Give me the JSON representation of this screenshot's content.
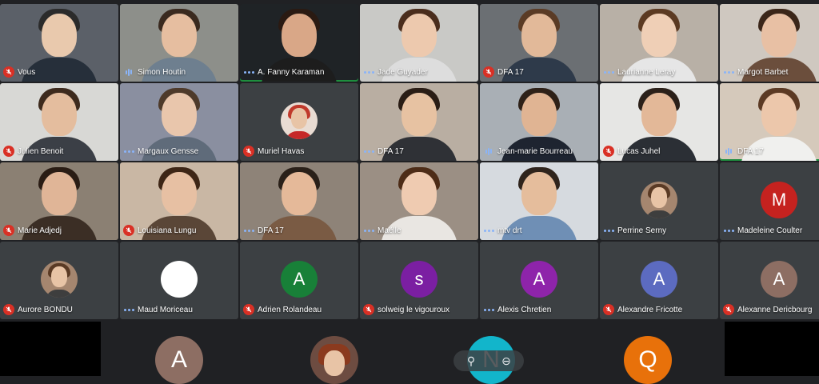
{
  "participants": [
    {
      "name": "Vous",
      "state": "muted"
    },
    {
      "name": "Simon Houtin",
      "state": "speaking"
    },
    {
      "name": "A. Fanny Karaman",
      "state": "dots"
    },
    {
      "name": "Jade Guyader",
      "state": "dots"
    },
    {
      "name": "DFA 17",
      "state": "muted"
    },
    {
      "name": "Laurianne Leray",
      "state": "dots"
    },
    {
      "name": "Margot Barbet",
      "state": "dots"
    },
    {
      "name": "Julien Benoit",
      "state": "muted"
    },
    {
      "name": "Margaux Gensse",
      "state": "dots"
    },
    {
      "name": "Muriel Havas",
      "state": "muted"
    },
    {
      "name": "DFA 17",
      "state": "dots"
    },
    {
      "name": "Jean-marie Bourreau",
      "state": "speaking"
    },
    {
      "name": "Lucas Juhel",
      "state": "muted"
    },
    {
      "name": "DFA 17",
      "state": "speaking"
    },
    {
      "name": "Marie Adjedj",
      "state": "muted"
    },
    {
      "name": "Louisiana Lungu",
      "state": "muted"
    },
    {
      "name": "DFA 17",
      "state": "dots"
    },
    {
      "name": "Maëlle",
      "state": "dots"
    },
    {
      "name": "mtv drt",
      "state": "dots"
    },
    {
      "name": "Perrine Serny",
      "state": "dots"
    },
    {
      "name": "Madeleine Coulter",
      "state": "dots",
      "initial": "M"
    },
    {
      "name": "Aurore BONDU",
      "state": "muted"
    },
    {
      "name": "Maud Moriceau",
      "state": "dots"
    },
    {
      "name": "Adrien Rolandeau",
      "state": "muted",
      "initial": "A"
    },
    {
      "name": "solweig le vigouroux",
      "state": "muted",
      "initial": "s"
    },
    {
      "name": "Alexis Chretien",
      "state": "dots",
      "initial": "A"
    },
    {
      "name": "Alexandre Fricotte",
      "state": "muted",
      "initial": "A"
    },
    {
      "name": "Alexanne Dericbourg",
      "state": "muted",
      "initial": "A"
    }
  ],
  "bottom_row": {
    "left_initial": "A",
    "pinned_initial": "N",
    "right_initial": "Q"
  },
  "colors": {
    "background": "#202124",
    "muted": "#d93025",
    "audio": "#8ab4f8",
    "avatar_red": "#c5221f",
    "avatar_green": "#188038",
    "avatar_purple": "#7b1fa2",
    "avatar_purple2": "#8e24aa",
    "avatar_blue": "#5c6bc0",
    "avatar_brown": "#8d6e63",
    "avatar_teal": "#12b5cb",
    "avatar_orange": "#e8710a"
  },
  "icons": [
    "mic-off-icon",
    "audio-level-icon",
    "pin-icon",
    "more-icon"
  ]
}
